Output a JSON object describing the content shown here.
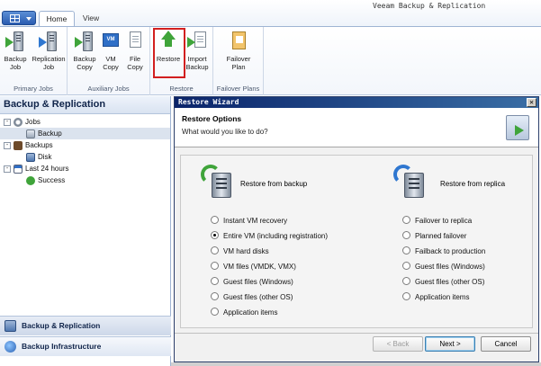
{
  "app": {
    "title": "Veeam Backup & Replication",
    "tabs": [
      "Home",
      "View"
    ]
  },
  "ribbon": {
    "groups": [
      {
        "label": "Primary Jobs",
        "buttons": [
          [
            "Backup",
            "Job"
          ],
          [
            "Replication",
            "Job"
          ]
        ]
      },
      {
        "label": "Auxiliary Jobs",
        "buttons": [
          [
            "Backup",
            "Copy"
          ],
          [
            "VM",
            "Copy"
          ],
          [
            "File",
            "Copy"
          ]
        ]
      },
      {
        "label": "Restore",
        "buttons": [
          [
            "Restore",
            ""
          ],
          [
            "Import",
            "Backup"
          ]
        ]
      },
      {
        "label": "Failover Plans",
        "buttons": [
          [
            "Failover",
            "Plan"
          ]
        ]
      }
    ]
  },
  "left_pane": {
    "title": "Backup & Replication",
    "tree": [
      {
        "label": "Jobs",
        "expander": "-"
      },
      {
        "label": "Backup"
      },
      {
        "label": "Backups",
        "expander": "-"
      },
      {
        "label": "Disk"
      },
      {
        "label": "Last 24 hours",
        "expander": "-"
      },
      {
        "label": "Success"
      }
    ],
    "nav": [
      "Backup & Replication",
      "Backup Infrastructure"
    ]
  },
  "wizard": {
    "title": "Restore Wizard",
    "close_glyph": "✕",
    "step_title": "Restore Options",
    "step_subtitle": "What would you like to do?",
    "backup_column": {
      "title": "Restore from backup",
      "options": [
        "Instant VM recovery",
        "Entire VM (including registration)",
        "VM hard disks",
        "VM files (VMDK, VMX)",
        "Guest files (Windows)",
        "Guest files (other OS)",
        "Application items"
      ],
      "selected_index": 1
    },
    "replica_column": {
      "title": "Restore from replica",
      "options": [
        "Failover to replica",
        "Planned failover",
        "Failback to production",
        "Guest files (Windows)",
        "Guest files (other OS)",
        "Application items"
      ]
    },
    "buttons": {
      "back": "< Back",
      "next": "Next >",
      "cancel": "Cancel"
    }
  },
  "colors": {
    "highlight": "#d21f1f",
    "accent": "#2f6fc7",
    "wizard_title_bar": "#0a246a"
  }
}
